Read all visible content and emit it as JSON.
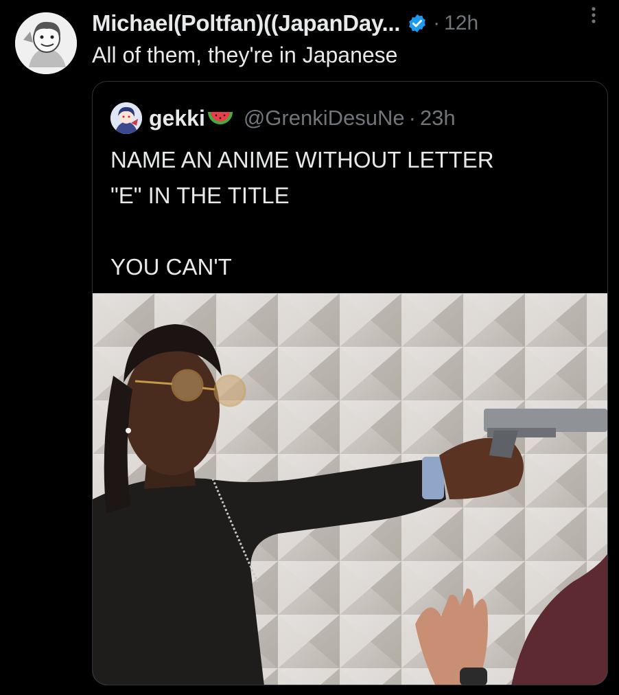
{
  "post": {
    "author": {
      "display_name": "Michael(Poltfan)((JapanDay...",
      "avatar_icon": "anime-avatar-icon",
      "verified_icon": "verified-badge-icon",
      "verified_color": "#1d9bf0"
    },
    "separator": "·",
    "timestamp": "12h",
    "more_icon": "more-options-icon",
    "text": "All of them, they're in Japanese"
  },
  "quote": {
    "author": {
      "display_name": "gekki",
      "emoji_icon": "watermelon-icon",
      "handle": "@GrenkiDesuNe",
      "avatar_icon": "anime-avatar-icon"
    },
    "separator": "·",
    "timestamp": "23h",
    "text_lines": [
      "NAME AN ANIME WITHOUT LETTER",
      "\"E\" IN THE TITLE",
      "",
      "YOU CAN'T"
    ],
    "media": {
      "type": "image",
      "subject": "man-pointing-pistol-photo"
    }
  },
  "colors": {
    "background": "#000000",
    "primary_text": "#e7e9ea",
    "secondary_text": "#71767b",
    "border": "#2f3336"
  }
}
